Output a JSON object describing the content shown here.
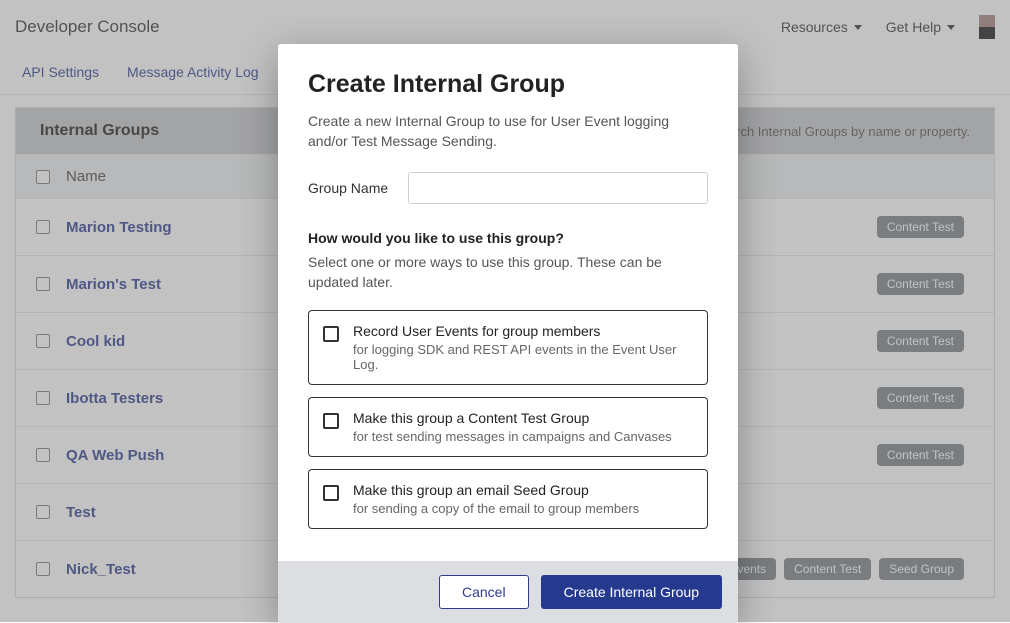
{
  "header": {
    "title": "Developer Console",
    "links": [
      "Resources",
      "Get Help"
    ]
  },
  "subnav": [
    "API Settings",
    "Message Activity Log"
  ],
  "panel": {
    "title": "Internal Groups",
    "search_placeholder": "Search Internal Groups by name or property.",
    "name_col": "Name"
  },
  "rows": [
    {
      "name": "Marion Testing",
      "tags": [
        "Content Test"
      ]
    },
    {
      "name": "Marion's Test",
      "tags": [
        "Content Test"
      ]
    },
    {
      "name": "Cool kid",
      "tags": [
        "Content Test"
      ]
    },
    {
      "name": "Ibotta Testers",
      "tags": [
        "Content Test"
      ]
    },
    {
      "name": "QA Web Push",
      "tags": [
        "Content Test"
      ]
    },
    {
      "name": "Test",
      "tags": []
    },
    {
      "name": "Nick_Test",
      "tags": [
        "User Events",
        "Content Test",
        "Seed Group"
      ]
    }
  ],
  "modal": {
    "title": "Create Internal Group",
    "subtitle": "Create a new Internal Group to use for User Event logging and/or Test Message Sending.",
    "group_name_label": "Group Name",
    "group_name_value": "",
    "question": "How would you like to use this group?",
    "question_sub": "Select one or more ways to use this group. These can be updated later.",
    "options": [
      {
        "title": "Record User Events for group members",
        "desc": "for logging SDK and REST API events in the Event User Log."
      },
      {
        "title": "Make this group a Content Test Group",
        "desc": "for test sending messages in campaigns and Canvases"
      },
      {
        "title": "Make this group an email Seed Group",
        "desc": "for sending a copy of the email to group members"
      }
    ],
    "cancel": "Cancel",
    "submit": "Create Internal Group"
  }
}
